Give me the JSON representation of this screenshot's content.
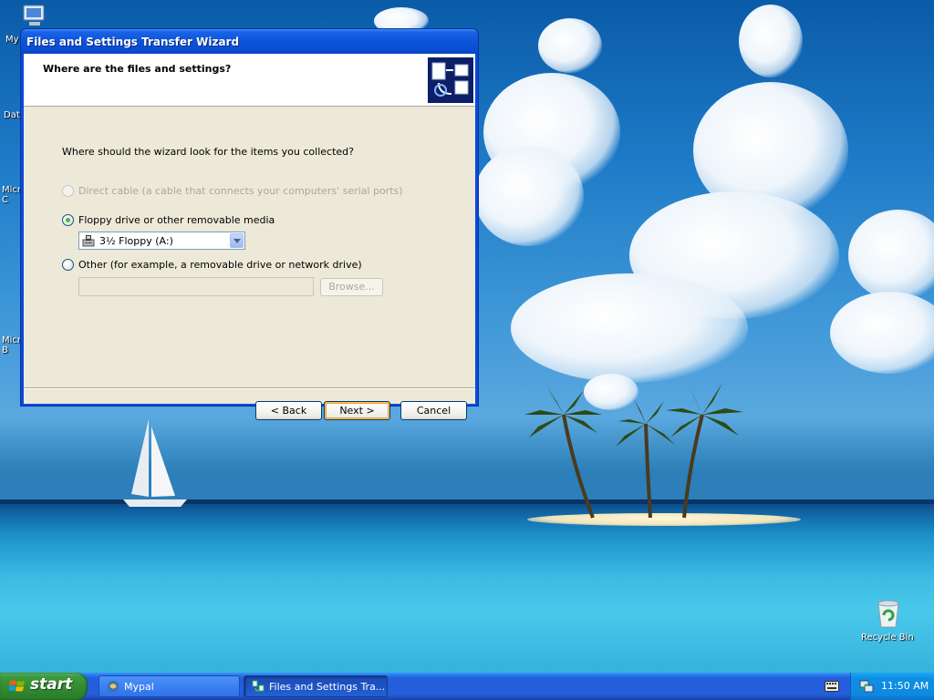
{
  "desktop": {
    "icons": [
      {
        "label": "My",
        "name": "my-computer"
      },
      {
        "label": "Dat",
        "name": "data"
      },
      {
        "label": "Micr\nC",
        "name": "microsoft-c"
      },
      {
        "label": "Micr\nB",
        "name": "microsoft-b"
      }
    ],
    "recycle_bin": {
      "label": "Recycle Bin",
      "icon": "recycle-bin-icon"
    }
  },
  "window": {
    "title": "Files and Settings Transfer Wizard",
    "heading": "Where are the files and settings?",
    "question": "Where should the wizard look for the items you collected?",
    "options": [
      {
        "label": "Direct cable (a cable that connects your computers' serial ports)",
        "selected": false,
        "enabled": false
      },
      {
        "label": "Floppy drive or other removable media",
        "selected": true,
        "enabled": true
      },
      {
        "label": "Other (for example, a removable drive or network drive)",
        "selected": false,
        "enabled": true
      }
    ],
    "drive_select": {
      "value": "3½ Floppy (A:)",
      "icon": "floppy-drive-icon"
    },
    "path_input": {
      "value": ""
    },
    "browse_label": "Browse...",
    "buttons": {
      "back": "< Back",
      "next": "Next >",
      "cancel": "Cancel"
    }
  },
  "taskbar": {
    "start_label": "start",
    "tasks": [
      {
        "label": "Mypal",
        "icon": "mypal-icon",
        "active": false
      },
      {
        "label": "Files and Settings Tra...",
        "icon": "transfer-wizard-icon",
        "active": true
      }
    ],
    "clock": "11:50 AM"
  },
  "colors": {
    "titlebar": "#0a4bd8",
    "taskbar": "#245edb",
    "start_button": "#318c31",
    "dialog_face": "#ece9d8"
  }
}
